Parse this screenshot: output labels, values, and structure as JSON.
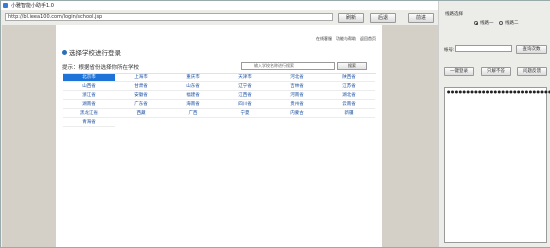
{
  "window": {
    "title": "小雅智能小助手1.0",
    "controls": [
      "_",
      "□",
      "×"
    ]
  },
  "toolbar": {
    "url": "http://bl.ieea100.com/login/school.jsp",
    "buttons": [
      "刷新",
      "后退",
      "前进"
    ]
  },
  "page": {
    "top_links": [
      "在线客服",
      "功能与帮助",
      "返回首页"
    ],
    "logo_text": "选择学校进行登录",
    "hint": "提示：根据省份选择你所在学校",
    "search_placeholder": "输入学校名称进行搜索",
    "search_button": "搜索",
    "provinces": [
      "北京市",
      "上海市",
      "重庆市",
      "天津市",
      "河北省",
      "陕西省",
      "山西省",
      "甘肃省",
      "山东省",
      "辽宁省",
      "吉林省",
      "江苏省",
      "浙江省",
      "安徽省",
      "福建省",
      "江西省",
      "河南省",
      "湖北省",
      "湖南省",
      "广东省",
      "海南省",
      "四川省",
      "贵州省",
      "云南省",
      "黑龙江省",
      "西藏",
      "广西",
      "宁夏",
      "内蒙古",
      "新疆",
      "青海省"
    ],
    "active_province": "北京市"
  },
  "panel": {
    "heading": "线路选择",
    "line_options": [
      "线路一",
      "线路二"
    ],
    "selected_line": "线路一",
    "account_label": "帐号:",
    "account_value": "",
    "query_button": "查询次数",
    "action_buttons": [
      "一键登录",
      "只解不答",
      "问题反馈"
    ],
    "log_text": "●●●●●●●●●●●●●●●●●●●●●●●●●●●●●●"
  }
}
